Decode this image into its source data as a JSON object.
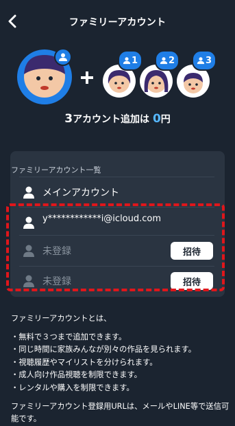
{
  "header": {
    "title": "ファミリーアカウント"
  },
  "hero": {
    "promo": {
      "prefix_num": "3",
      "text": "アカウント追加は",
      "price_num": "0",
      "price_unit": "円"
    },
    "family_badges": [
      "1",
      "2",
      "3"
    ]
  },
  "card": {
    "title": "ファミリーアカウント一覧",
    "rows": [
      {
        "label": "メインアカウント",
        "type": "main"
      },
      {
        "label": "y************i@icloud.com",
        "type": "member"
      },
      {
        "label": "未登録",
        "type": "empty",
        "button": "招待"
      },
      {
        "label": "未登録",
        "type": "empty",
        "button": "招待"
      }
    ]
  },
  "info": {
    "heading": "ファミリーアカウントとは、",
    "bullets": [
      "・無料で３つまで追加できます。",
      "・同じ時間に家族みんなが別々の作品を見られます。",
      "・視聴履歴やマイリストを分けられます。",
      "・成人向け作品視聴を制限できます。",
      "・レンタルや購入を制限できます。"
    ],
    "footer": "ファミリーアカウント登録用URLは、メールやLINE等で送信可能です。"
  },
  "colors": {
    "background": "#1b2430",
    "card": "#2a3441",
    "accent_blue": "#1f7ee6",
    "highlight_red": "#e0161b"
  }
}
